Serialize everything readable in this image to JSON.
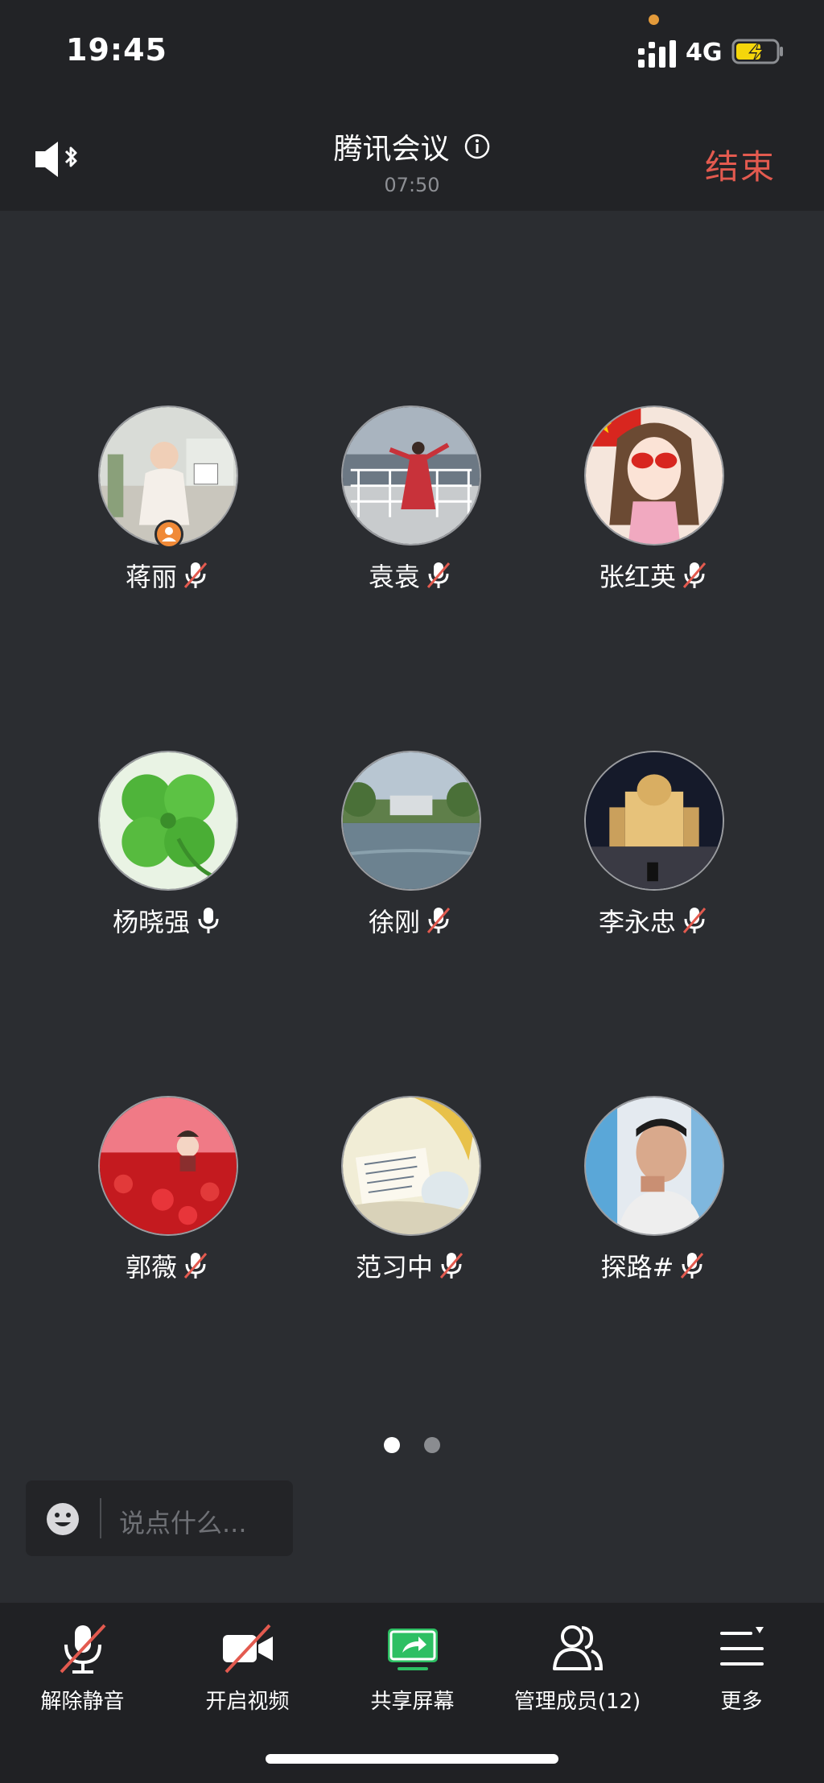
{
  "status_bar": {
    "time": "19:45",
    "network": "4G",
    "signal_icon": "cellular-signal-icon",
    "battery_icon": "battery-charging-icon"
  },
  "header": {
    "title": "腾讯会议",
    "duration": "07:50",
    "end_label": "结束",
    "speaker_icon": "bluetooth-speaker-icon",
    "info_icon": "info-icon"
  },
  "participants": [
    {
      "name": "蒋丽",
      "muted": true,
      "host": true
    },
    {
      "name": "袁袁",
      "muted": true,
      "host": false
    },
    {
      "name": "张红英",
      "muted": true,
      "host": false
    },
    {
      "name": "杨晓强",
      "muted": false,
      "host": false
    },
    {
      "name": "徐刚",
      "muted": true,
      "host": false
    },
    {
      "name": "李永忠",
      "muted": true,
      "host": false
    },
    {
      "name": "郭薇",
      "muted": true,
      "host": false
    },
    {
      "name": "范习中",
      "muted": true,
      "host": false
    },
    {
      "name": "探路#",
      "muted": true,
      "host": false
    }
  ],
  "pagination": {
    "current": 1,
    "total": 2
  },
  "chat": {
    "placeholder": "说点什么..."
  },
  "toolbar": {
    "unmute_label": "解除静音",
    "video_label": "开启视频",
    "share_label": "共享屏幕",
    "members_label": "管理成员(12)",
    "more_label": "更多"
  },
  "colors": {
    "accent_red": "#e35a4f",
    "share_green": "#2dbf63",
    "host_orange": "#f08a38",
    "background": "#2b2d31"
  }
}
